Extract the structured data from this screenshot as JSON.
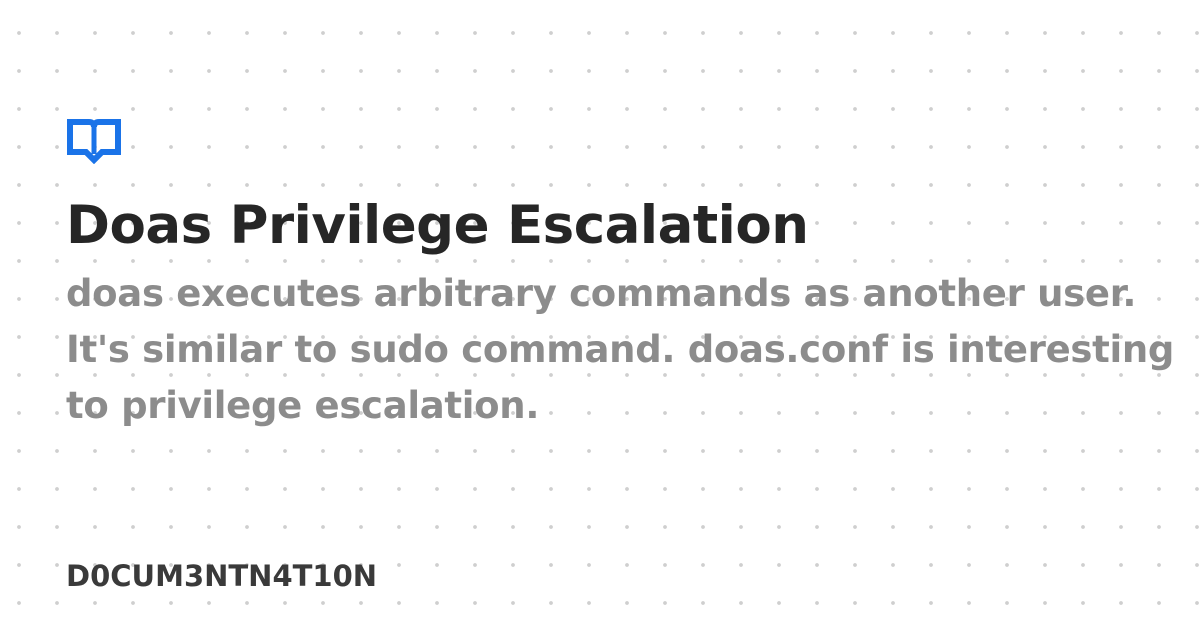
{
  "logo": {
    "icon": "open-book-icon",
    "color": "#1a73e8"
  },
  "page": {
    "title": "Doas Privilege Escalation",
    "description": "doas executes arbitrary commands as another user. It's similar to sudo command. doas.conf is interesting to privilege escalation."
  },
  "site": {
    "name": "D0CUM3NTN4T10N"
  }
}
